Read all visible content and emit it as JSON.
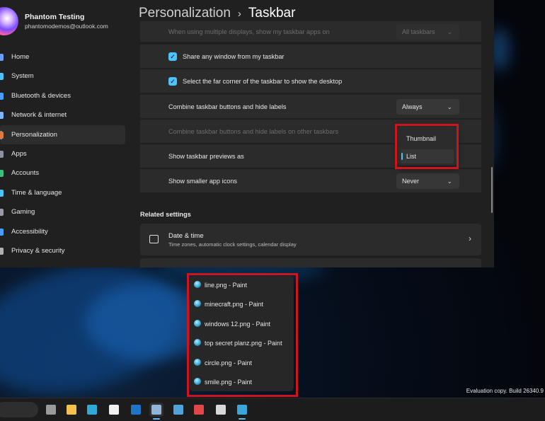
{
  "profile": {
    "name": "Phantom Testing",
    "email": "phantomodemos@outlook.com"
  },
  "breadcrumb": {
    "parent": "Personalization",
    "separator": "›",
    "current": "Taskbar"
  },
  "sidebar": {
    "items": [
      {
        "label": "Home",
        "color": "#6b9cff"
      },
      {
        "label": "System",
        "color": "#4cc2ff"
      },
      {
        "label": "Bluetooth & devices",
        "color": "#4c9dff"
      },
      {
        "label": "Network & internet",
        "color": "#7fb3ff"
      },
      {
        "label": "Personalization",
        "color": "#e07a3c",
        "active": true
      },
      {
        "label": "Apps",
        "color": "#8f8fa3"
      },
      {
        "label": "Accounts",
        "color": "#3fbf7f"
      },
      {
        "label": "Time & language",
        "color": "#4cc2ff"
      },
      {
        "label": "Gaming",
        "color": "#9a9aa8"
      },
      {
        "label": "Accessibility",
        "color": "#4c9dff"
      },
      {
        "label": "Privacy & security",
        "color": "#b0b0b0"
      }
    ]
  },
  "settings": {
    "multi_display_label": "When using multiple displays, show my taskbar apps on",
    "multi_display_value": "All taskbars",
    "share_window_label": "Share any window from my taskbar",
    "share_window_checked": true,
    "far_corner_label": "Select the far corner of the taskbar to show the desktop",
    "far_corner_checked": true,
    "combine_label": "Combine taskbar buttons and hide labels",
    "combine_value": "Always",
    "combine_other_label": "Combine taskbar buttons and hide labels on other taskbars",
    "previews_label": "Show taskbar previews as",
    "smaller_icons_label": "Show smaller app icons",
    "smaller_icons_value": "Never",
    "check_glyph": "✓",
    "chevron_glyph": "⌄"
  },
  "flyout": {
    "options": [
      "Thumbnail",
      "List"
    ],
    "selected": "List"
  },
  "related": {
    "heading": "Related settings",
    "datetime_title": "Date & time",
    "datetime_sub": "Time zones, automatic clock settings, calendar display",
    "arrow": "›"
  },
  "previews": {
    "items": [
      "line.png - Paint",
      "minecraft.png - Paint",
      "windows 12.png - Paint",
      "top secret planz.png - Paint",
      "circle.png - Paint",
      "smile.png - Paint"
    ]
  },
  "watermark": "Evaluation copy. Build 26340.9",
  "taskbar": {
    "icons": [
      {
        "name": "task-view-icon",
        "color": "#9a9a9a"
      },
      {
        "name": "file-explorer-icon",
        "color": "#f2c14e"
      },
      {
        "name": "edge-icon",
        "color": "#2fa9d6"
      },
      {
        "name": "store-icon",
        "color": "#f0f0f0"
      },
      {
        "name": "outlook-icon",
        "color": "#1e74c9"
      },
      {
        "name": "settings-icon",
        "color": "#8fb6d8",
        "active": true
      },
      {
        "name": "notepad-icon",
        "color": "#4fa3d9"
      },
      {
        "name": "snipping-tool-icon",
        "color": "#e04848"
      },
      {
        "name": "clock-icon",
        "color": "#d8d8d8"
      },
      {
        "name": "paint-icon",
        "color": "#3aa6d9",
        "running": true
      }
    ]
  },
  "colors": {
    "accent": "#4cc2ff",
    "highlight": "#d0141e",
    "window": "#202020",
    "card": "#2b2b2b"
  }
}
